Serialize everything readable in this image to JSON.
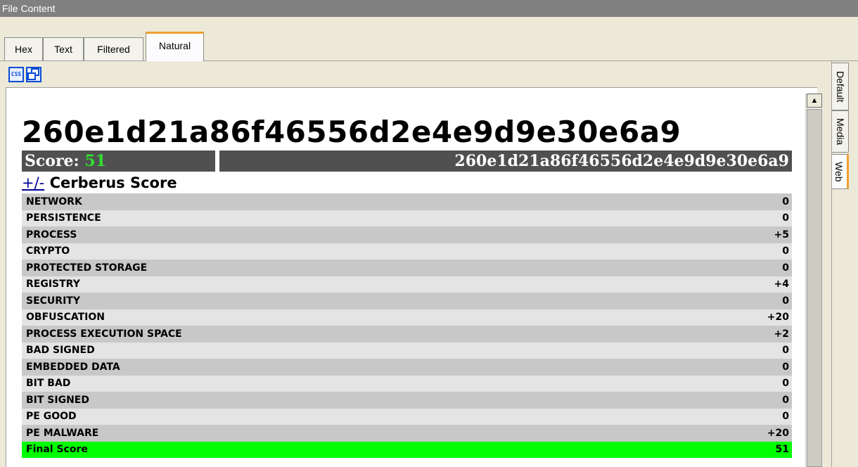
{
  "window": {
    "title": "File Content"
  },
  "tabs": [
    {
      "label": "Hex",
      "active": false
    },
    {
      "label": "Text",
      "active": false
    },
    {
      "label": "Filtered",
      "active": false
    },
    {
      "label": "Natural",
      "active": true
    }
  ],
  "toolbar": {
    "buttons": [
      {
        "icon": "css-icon",
        "label": "CSS"
      },
      {
        "icon": "new-window-icon"
      }
    ]
  },
  "side_tabs": [
    {
      "label": "Default",
      "active": false
    },
    {
      "label": "Media",
      "active": false
    },
    {
      "label": "Web",
      "active": true
    }
  ],
  "report": {
    "hash": "260e1d21a86f46556d2e4e9d9e30e6a9",
    "score_label": "Score: ",
    "score_value": "51",
    "hash_banner": "260e1d21a86f46556d2e4e9d9e30e6a9",
    "section_toggle": "+/-",
    "section_title": "Cerberus Score",
    "rows": [
      {
        "name": "NETWORK",
        "value": "0"
      },
      {
        "name": "PERSISTENCE",
        "value": "0"
      },
      {
        "name": "PROCESS",
        "value": "+5"
      },
      {
        "name": "CRYPTO",
        "value": "0"
      },
      {
        "name": "PROTECTED STORAGE",
        "value": "0"
      },
      {
        "name": "REGISTRY",
        "value": "+4"
      },
      {
        "name": "SECURITY",
        "value": "0"
      },
      {
        "name": "OBFUSCATION",
        "value": "+20"
      },
      {
        "name": "PROCESS EXECUTION SPACE",
        "value": "+2"
      },
      {
        "name": "BAD SIGNED",
        "value": "0"
      },
      {
        "name": "EMBEDDED DATA",
        "value": "0"
      },
      {
        "name": "BIT BAD",
        "value": "0"
      },
      {
        "name": "BIT SIGNED",
        "value": "0"
      },
      {
        "name": "PE GOOD",
        "value": "0"
      },
      {
        "name": "PE MALWARE",
        "value": "+20"
      }
    ],
    "final": {
      "name": "Final Score",
      "value": "51"
    }
  },
  "colors": {
    "score_value": "#30e030",
    "final_row": "#00ff00",
    "active_tab_accent": "#f0a030"
  }
}
